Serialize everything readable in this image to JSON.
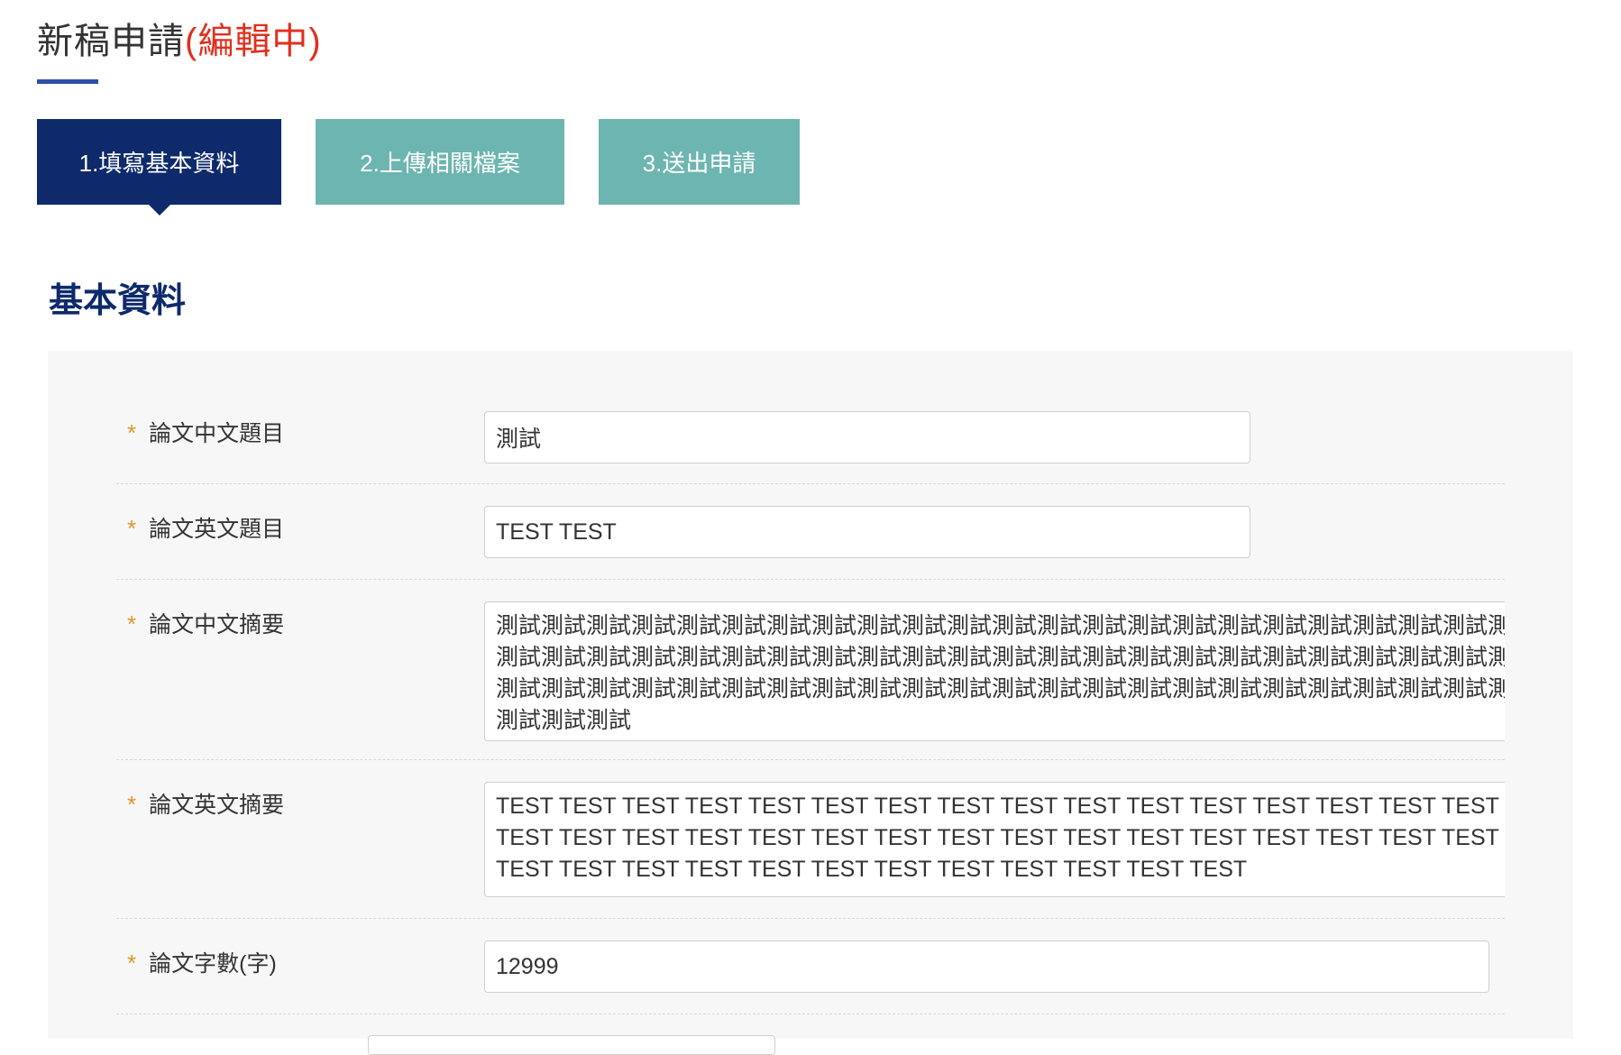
{
  "page": {
    "title": "新稿申請",
    "status": "(編輯中)"
  },
  "steps": [
    {
      "label": "1.填寫基本資料",
      "active": true
    },
    {
      "label": "2.上傳相關檔案",
      "active": false
    },
    {
      "label": "3.送出申請",
      "active": false
    }
  ],
  "section": {
    "heading": "基本資料"
  },
  "form": {
    "required_mark": "*",
    "fields": [
      {
        "label": "論文中文題目",
        "value": "測試"
      },
      {
        "label": "論文英文題目",
        "value": "TEST TEST"
      },
      {
        "label": "論文中文摘要",
        "value": "測試測試測試測試測試測試測試測試測試測試測試測試測試測試測試測試測試測試測試測試測試測試測試測試測試測試測試測試測試測試測試測試測試測試測試測試測試測試測試測試測試測試測試測試測試測試測試測試測試測試測試測試測試測試測試測試測試測試測試測試測試測試測試測試測試測試測試測試測試測試測試測試測試測試測試"
      },
      {
        "label": "論文英文摘要",
        "value": "TEST TEST TEST TEST TEST TEST TEST TEST TEST TEST TEST TEST TEST TEST TEST TEST TEST TEST TEST TEST TEST TEST TEST TEST TEST TEST TEST TEST TEST TEST TEST TEST TEST TEST TEST TEST TEST TEST TEST TEST TEST TEST TEST TEST TEST TEST"
      },
      {
        "label": "論文字數(字)",
        "value": "12999"
      }
    ]
  },
  "colors": {
    "title_status": "#e0301e",
    "step_active": "#0e2a6b",
    "step_inactive": "#6db5b0",
    "heading": "#0e2a6b",
    "required": "#e2962a",
    "title_underline": "#2f4fa8",
    "panel_bg": "#f7f7f7"
  }
}
